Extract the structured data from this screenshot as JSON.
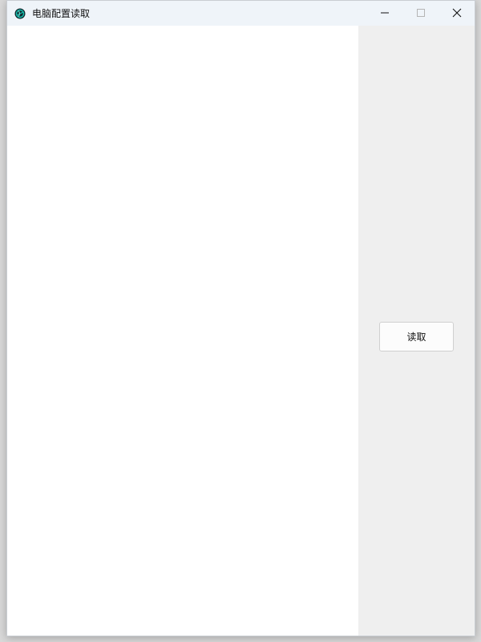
{
  "window": {
    "title": "电脑配置读取",
    "icon": "app-globe-icon",
    "controls": {
      "minimize_icon": "minimize-icon",
      "maximize_icon": "maximize-icon",
      "close_icon": "close-icon"
    }
  },
  "output_area": {
    "text": ""
  },
  "actions": {
    "read_label": "读取"
  },
  "colors": {
    "titlebar_bg": "#eff4f9",
    "side_panel_bg": "#efefef",
    "button_bg": "#fcfcfc",
    "icon_accent": "#18c0b0"
  }
}
